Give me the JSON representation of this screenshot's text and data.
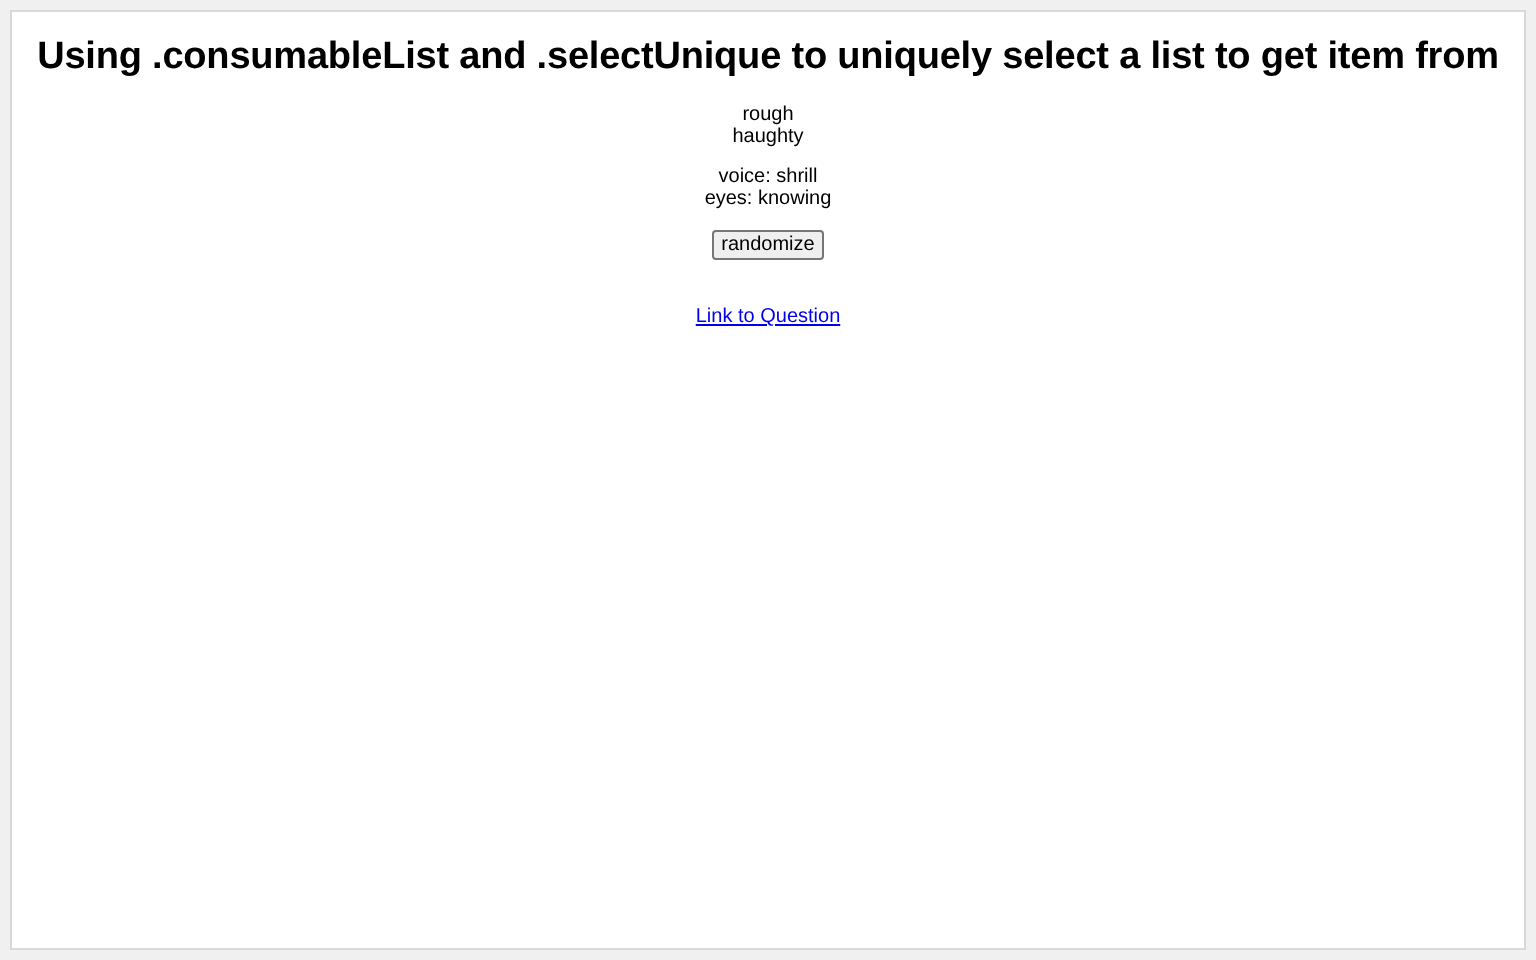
{
  "title": "Using .consumableList and .selectUnique to uniquely select a list to get item from",
  "traits": [
    "rough",
    "haughty"
  ],
  "attributes": [
    {
      "label": "voice:",
      "value": "shrill"
    },
    {
      "label": "eyes:",
      "value": "knowing"
    }
  ],
  "button": "randomize",
  "link": "Link to Question"
}
